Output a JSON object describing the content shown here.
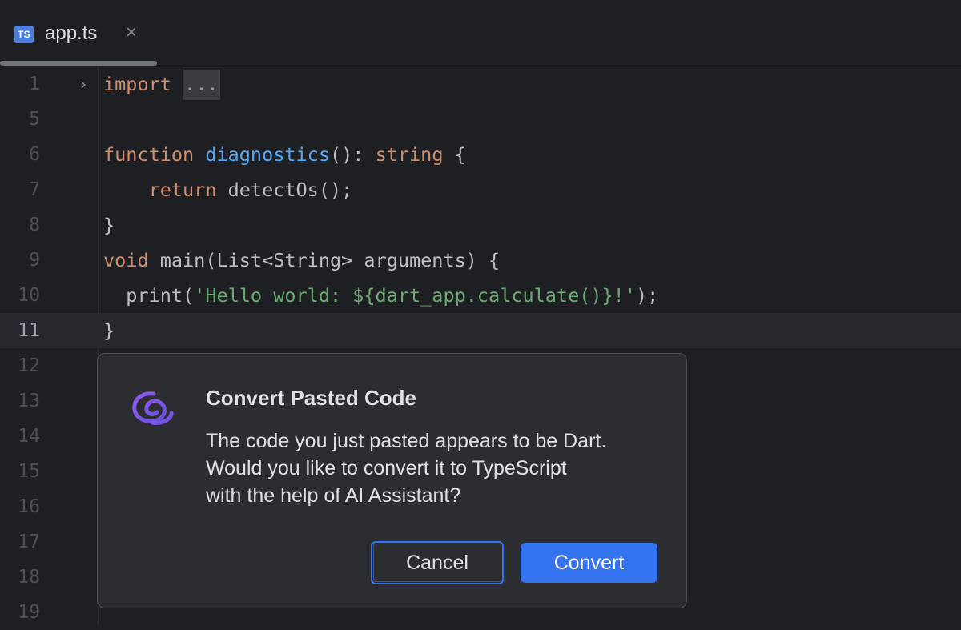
{
  "tab": {
    "icon_label": "TS",
    "file_name": "app.ts",
    "close_glyph": "×"
  },
  "editor": {
    "lines": [
      {
        "number": "1",
        "tokens": [
          {
            "t": "import",
            "c": "kw"
          },
          {
            "t": " ",
            "c": ""
          },
          {
            "t": "...",
            "c": "folded"
          }
        ],
        "fold": "›"
      },
      {
        "number": "5",
        "tokens": []
      },
      {
        "number": "6",
        "tokens": [
          {
            "t": "function",
            "c": "kw"
          },
          {
            "t": " ",
            "c": ""
          },
          {
            "t": "diagnostics",
            "c": "fn"
          },
          {
            "t": "(): ",
            "c": ""
          },
          {
            "t": "string",
            "c": "kw"
          },
          {
            "t": " {",
            "c": ""
          }
        ]
      },
      {
        "number": "7",
        "tokens": [
          {
            "t": "    ",
            "c": ""
          },
          {
            "t": "return",
            "c": "kw"
          },
          {
            "t": " detectOs();",
            "c": ""
          }
        ]
      },
      {
        "number": "8",
        "tokens": [
          {
            "t": "}",
            "c": ""
          }
        ]
      },
      {
        "number": "9",
        "tokens": [
          {
            "t": "void",
            "c": "kw"
          },
          {
            "t": " main(List<String> arguments) {",
            "c": ""
          }
        ]
      },
      {
        "number": "10",
        "tokens": [
          {
            "t": "  print(",
            "c": ""
          },
          {
            "t": "'Hello world: ${dart_app.calculate()}!'",
            "c": "str"
          },
          {
            "t": ");",
            "c": ""
          }
        ]
      },
      {
        "number": "11",
        "tokens": [
          {
            "t": "}",
            "c": ""
          }
        ],
        "current": true
      },
      {
        "number": "12",
        "tokens": []
      },
      {
        "number": "13",
        "tokens": []
      },
      {
        "number": "14",
        "tokens": []
      },
      {
        "number": "15",
        "tokens": []
      },
      {
        "number": "16",
        "tokens": []
      },
      {
        "number": "17",
        "tokens": []
      },
      {
        "number": "18",
        "tokens": []
      },
      {
        "number": "19",
        "tokens": []
      }
    ]
  },
  "popup": {
    "icon": "ai-assistant-icon",
    "title": "Convert Pasted Code",
    "body_lines": [
      "The code you just pasted appears to be Dart.",
      "Would you like to convert it to TypeScript",
      "with the help of AI Assistant?"
    ],
    "cancel_label": "Cancel",
    "convert_label": "Convert"
  },
  "colors": {
    "background": "#1e1f22",
    "keyword": "#cf8e6d",
    "function": "#56a8f5",
    "string": "#6aab73",
    "accent": "#3574f0"
  }
}
